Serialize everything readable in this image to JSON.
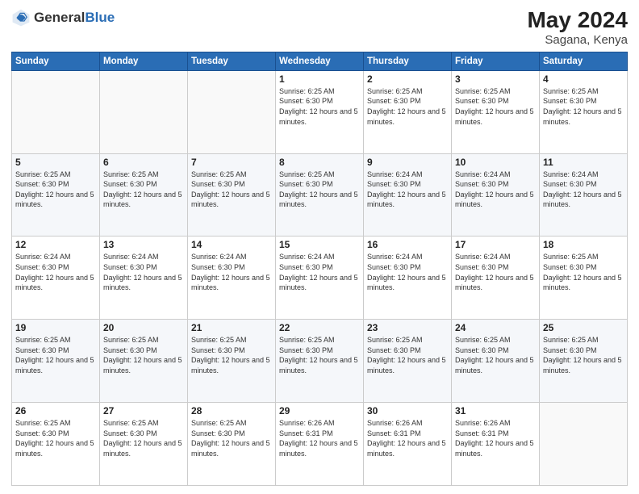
{
  "logo": {
    "general": "General",
    "blue": "Blue"
  },
  "header": {
    "month_year": "May 2024",
    "location": "Sagana, Kenya"
  },
  "weekdays": [
    "Sunday",
    "Monday",
    "Tuesday",
    "Wednesday",
    "Thursday",
    "Friday",
    "Saturday"
  ],
  "weeks": [
    [
      {
        "day": "",
        "info": ""
      },
      {
        "day": "",
        "info": ""
      },
      {
        "day": "",
        "info": ""
      },
      {
        "day": "1",
        "info": "Sunrise: 6:25 AM\nSunset: 6:30 PM\nDaylight: 12 hours\nand 5 minutes."
      },
      {
        "day": "2",
        "info": "Sunrise: 6:25 AM\nSunset: 6:30 PM\nDaylight: 12 hours\nand 5 minutes."
      },
      {
        "day": "3",
        "info": "Sunrise: 6:25 AM\nSunset: 6:30 PM\nDaylight: 12 hours\nand 5 minutes."
      },
      {
        "day": "4",
        "info": "Sunrise: 6:25 AM\nSunset: 6:30 PM\nDaylight: 12 hours\nand 5 minutes."
      }
    ],
    [
      {
        "day": "5",
        "info": "Sunrise: 6:25 AM\nSunset: 6:30 PM\nDaylight: 12 hours\nand 5 minutes."
      },
      {
        "day": "6",
        "info": "Sunrise: 6:25 AM\nSunset: 6:30 PM\nDaylight: 12 hours\nand 5 minutes."
      },
      {
        "day": "7",
        "info": "Sunrise: 6:25 AM\nSunset: 6:30 PM\nDaylight: 12 hours\nand 5 minutes."
      },
      {
        "day": "8",
        "info": "Sunrise: 6:25 AM\nSunset: 6:30 PM\nDaylight: 12 hours\nand 5 minutes."
      },
      {
        "day": "9",
        "info": "Sunrise: 6:24 AM\nSunset: 6:30 PM\nDaylight: 12 hours\nand 5 minutes."
      },
      {
        "day": "10",
        "info": "Sunrise: 6:24 AM\nSunset: 6:30 PM\nDaylight: 12 hours\nand 5 minutes."
      },
      {
        "day": "11",
        "info": "Sunrise: 6:24 AM\nSunset: 6:30 PM\nDaylight: 12 hours\nand 5 minutes."
      }
    ],
    [
      {
        "day": "12",
        "info": "Sunrise: 6:24 AM\nSunset: 6:30 PM\nDaylight: 12 hours\nand 5 minutes."
      },
      {
        "day": "13",
        "info": "Sunrise: 6:24 AM\nSunset: 6:30 PM\nDaylight: 12 hours\nand 5 minutes."
      },
      {
        "day": "14",
        "info": "Sunrise: 6:24 AM\nSunset: 6:30 PM\nDaylight: 12 hours\nand 5 minutes."
      },
      {
        "day": "15",
        "info": "Sunrise: 6:24 AM\nSunset: 6:30 PM\nDaylight: 12 hours\nand 5 minutes."
      },
      {
        "day": "16",
        "info": "Sunrise: 6:24 AM\nSunset: 6:30 PM\nDaylight: 12 hours\nand 5 minutes."
      },
      {
        "day": "17",
        "info": "Sunrise: 6:24 AM\nSunset: 6:30 PM\nDaylight: 12 hours\nand 5 minutes."
      },
      {
        "day": "18",
        "info": "Sunrise: 6:25 AM\nSunset: 6:30 PM\nDaylight: 12 hours\nand 5 minutes."
      }
    ],
    [
      {
        "day": "19",
        "info": "Sunrise: 6:25 AM\nSunset: 6:30 PM\nDaylight: 12 hours\nand 5 minutes."
      },
      {
        "day": "20",
        "info": "Sunrise: 6:25 AM\nSunset: 6:30 PM\nDaylight: 12 hours\nand 5 minutes."
      },
      {
        "day": "21",
        "info": "Sunrise: 6:25 AM\nSunset: 6:30 PM\nDaylight: 12 hours\nand 5 minutes."
      },
      {
        "day": "22",
        "info": "Sunrise: 6:25 AM\nSunset: 6:30 PM\nDaylight: 12 hours\nand 5 minutes."
      },
      {
        "day": "23",
        "info": "Sunrise: 6:25 AM\nSunset: 6:30 PM\nDaylight: 12 hours\nand 5 minutes."
      },
      {
        "day": "24",
        "info": "Sunrise: 6:25 AM\nSunset: 6:30 PM\nDaylight: 12 hours\nand 5 minutes."
      },
      {
        "day": "25",
        "info": "Sunrise: 6:25 AM\nSunset: 6:30 PM\nDaylight: 12 hours\nand 5 minutes."
      }
    ],
    [
      {
        "day": "26",
        "info": "Sunrise: 6:25 AM\nSunset: 6:30 PM\nDaylight: 12 hours\nand 5 minutes."
      },
      {
        "day": "27",
        "info": "Sunrise: 6:25 AM\nSunset: 6:30 PM\nDaylight: 12 hours\nand 5 minutes."
      },
      {
        "day": "28",
        "info": "Sunrise: 6:25 AM\nSunset: 6:30 PM\nDaylight: 12 hours\nand 5 minutes."
      },
      {
        "day": "29",
        "info": "Sunrise: 6:26 AM\nSunset: 6:31 PM\nDaylight: 12 hours\nand 5 minutes."
      },
      {
        "day": "30",
        "info": "Sunrise: 6:26 AM\nSunset: 6:31 PM\nDaylight: 12 hours\nand 5 minutes."
      },
      {
        "day": "31",
        "info": "Sunrise: 6:26 AM\nSunset: 6:31 PM\nDaylight: 12 hours\nand 5 minutes."
      },
      {
        "day": "",
        "info": ""
      }
    ]
  ]
}
